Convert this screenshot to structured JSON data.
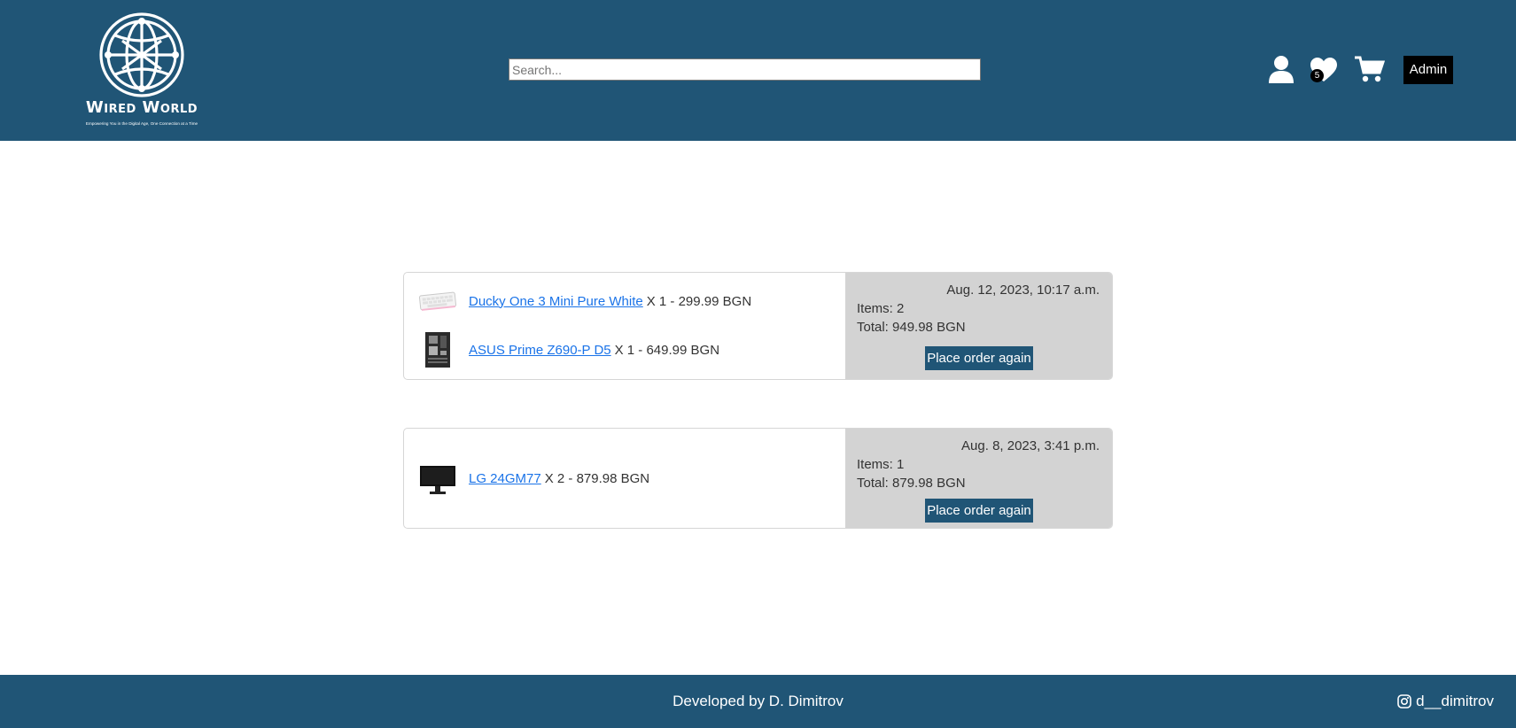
{
  "header": {
    "logo": {
      "title": "Wired World",
      "tagline": "Empowering You in the Digital Age, One Connection at a Time"
    },
    "search": {
      "placeholder": "Search...",
      "value": ""
    },
    "icons": {
      "profile": "user-icon",
      "wishlist": "heart-icon",
      "cart": "cart-icon"
    },
    "wishlist_count": "5",
    "admin_label": "Admin"
  },
  "orders": [
    {
      "items": [
        {
          "name": "Ducky One 3 Mini Pure White",
          "detail": "X 1 - 299.99 BGN",
          "thumb": "keyboard-thumbnail"
        },
        {
          "name": "ASUS Prime Z690-P D5",
          "detail": "X 1 - 649.99 BGN",
          "thumb": "motherboard-thumbnail"
        }
      ],
      "date": "Aug. 12, 2023, 10:17 a.m.",
      "items_count": "Items: 2",
      "total": "Total: 949.98 BGN",
      "button_label": "Place order again"
    },
    {
      "items": [
        {
          "name": "LG 24GM77",
          "detail": "X 2 - 879.98 BGN",
          "thumb": "monitor-thumbnail"
        }
      ],
      "date": "Aug. 8, 2023, 3:41 p.m.",
      "items_count": "Items: 1",
      "total": "Total: 879.98 BGN",
      "button_label": "Place order again"
    }
  ],
  "footer": {
    "credit": "Developed by D. Dimitrov",
    "instagram_handle": "d__dimitrov",
    "instagram_icon": "instagram-icon"
  },
  "colors": {
    "header_bg": "#205576",
    "summary_bg": "#d3d3d3",
    "link": "#1a73e8",
    "admin_bg": "#000000"
  }
}
